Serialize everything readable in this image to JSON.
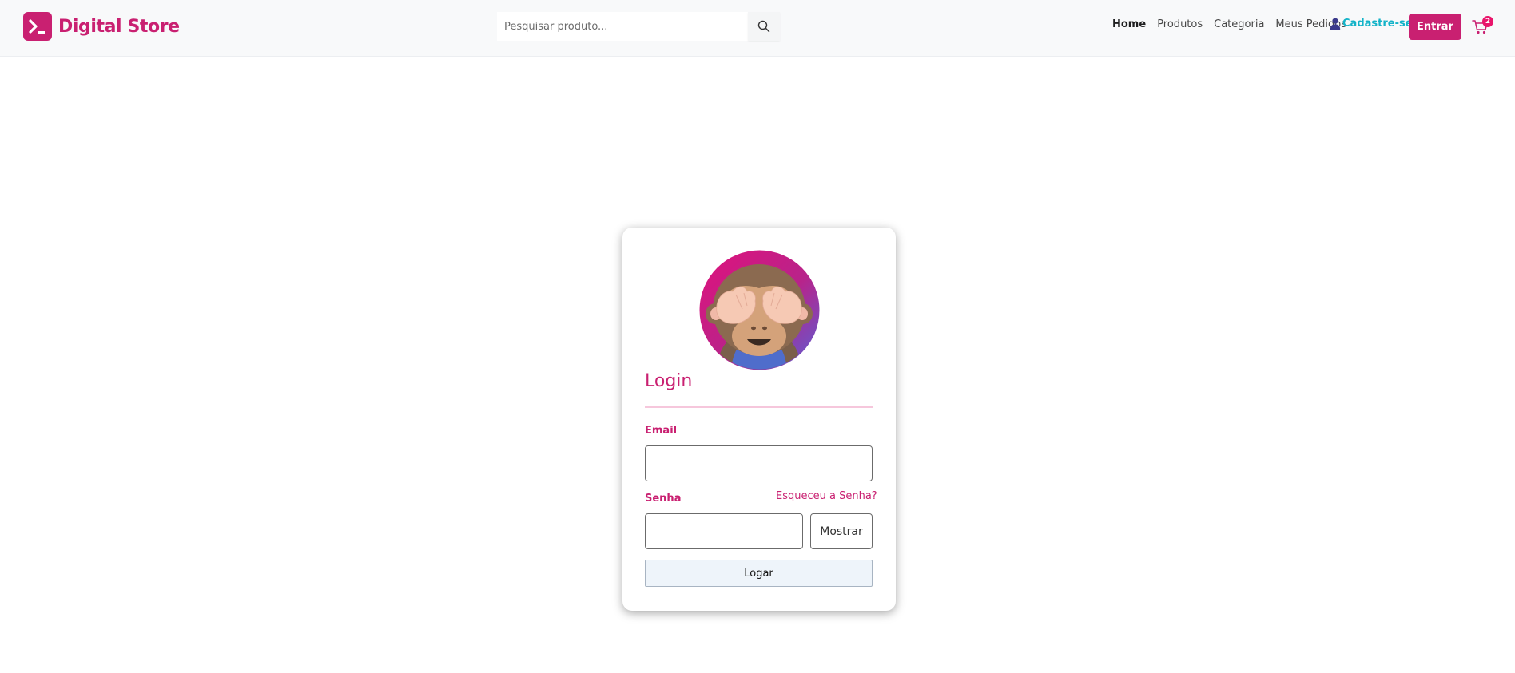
{
  "brand": {
    "name": "Digital Store",
    "color": "#c92071",
    "logo_icon": "terminal-prompt-icon"
  },
  "search": {
    "placeholder": "Pesquisar produto...",
    "icon": "search-icon"
  },
  "nav": {
    "links": [
      {
        "label": "Home",
        "active": true
      },
      {
        "label": "Produtos",
        "active": false
      },
      {
        "label": "Categoria",
        "active": false
      },
      {
        "label": "Meus Pedidos",
        "active": false
      }
    ],
    "signup_label": "Cadastre-se",
    "signup_icon": "user-icon",
    "enter_label": "Entrar",
    "cart_icon": "cart-icon",
    "cart_count": "2"
  },
  "login": {
    "title": "Login",
    "avatar": "see-no-evil-monkey-avatar",
    "email_label": "Email",
    "email_value": "",
    "password_label": "Senha",
    "password_value": "",
    "forgot_label": "Esqueceu a Senha?",
    "show_label": "Mostrar",
    "submit_label": "Logar"
  },
  "colors": {
    "accent": "#c92071",
    "signup": "#13b3c8",
    "badge": "#e9156b"
  }
}
